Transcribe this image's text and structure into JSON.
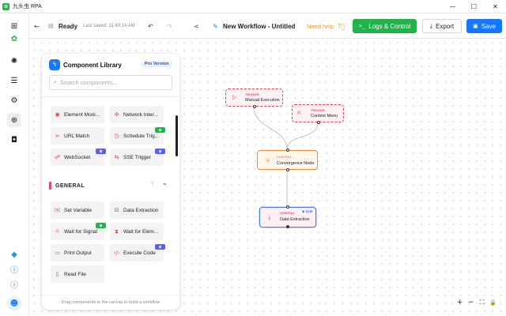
{
  "app": {
    "icon": "bug-icon",
    "title": "九头虫 RPA"
  },
  "window_controls": {
    "minimize": "—",
    "maximize": "☐",
    "close": "✕"
  },
  "rail": {
    "items": [
      "apps-grid-icon",
      "workflow-icon",
      "database-icon",
      "gear-icon",
      "plus-circle-icon",
      "robot-icon"
    ],
    "bottom": [
      "diamond-icon",
      "help-icon",
      "info-icon",
      "user-icon"
    ]
  },
  "toolbar": {
    "status": "Ready",
    "last_saved": "Last saved: 11:40:14 AM",
    "workflow_title": "New Workflow - Untitled",
    "need_help": "Need help",
    "logs_label": "Logs & Control",
    "export_label": "Export",
    "save_label": "Save"
  },
  "colors": {
    "accent_green": "#22b34a",
    "accent_blue": "#1677ff",
    "help_orange": "#f29b14",
    "trigger_red": "#e5434f",
    "control_orange": "#f08b3a",
    "general_pink": "#e2447a"
  },
  "library": {
    "title": "Component Library",
    "pro": "Pro Version",
    "search_placeholder": "Search components...",
    "items": [
      {
        "label": "Element Moni...",
        "icon": "eye-icon"
      },
      {
        "label": "Network Inter...",
        "icon": "network-icon"
      },
      {
        "label": "URL Match",
        "icon": "link-icon"
      },
      {
        "label": "Schedule Trig...",
        "icon": "clock-icon",
        "badge": "⊕"
      },
      {
        "label": "WebSocket",
        "icon": "websocket-icon",
        "badge": "♛"
      },
      {
        "label": "SSE Trigger",
        "icon": "sse-icon",
        "badge": "♛"
      }
    ],
    "section": {
      "title": "GENERAL",
      "help": "?",
      "chevron": "⌄"
    },
    "general_items": [
      {
        "label": "Set Variable",
        "icon": "variable-icon"
      },
      {
        "label": "Data Extraction",
        "icon": "table-icon"
      },
      {
        "label": "Wait for Signal",
        "icon": "signal-icon",
        "badge": "⊕"
      },
      {
        "label": "Wait for Elem...",
        "icon": "hourglass-icon"
      },
      {
        "label": "Print Output",
        "icon": "print-icon"
      },
      {
        "label": "Execute Code",
        "icon": "code-icon",
        "badge": "♛"
      },
      {
        "label": "Read File",
        "icon": "file-icon"
      }
    ],
    "footer": "Drag components to the canvas to build a workflow"
  },
  "nodes": [
    {
      "kind": "TRIGGER",
      "name": "Manual Execution"
    },
    {
      "kind": "TRIGGER",
      "name": "Context Menu"
    },
    {
      "kind": "CONTROL",
      "name": "Convergence Node"
    },
    {
      "kind": "GENERAL",
      "name": "Data Extraction",
      "tag": "♛ SVIP"
    }
  ],
  "canvas_controls": [
    "+",
    "−",
    "⛶",
    "🔒"
  ]
}
